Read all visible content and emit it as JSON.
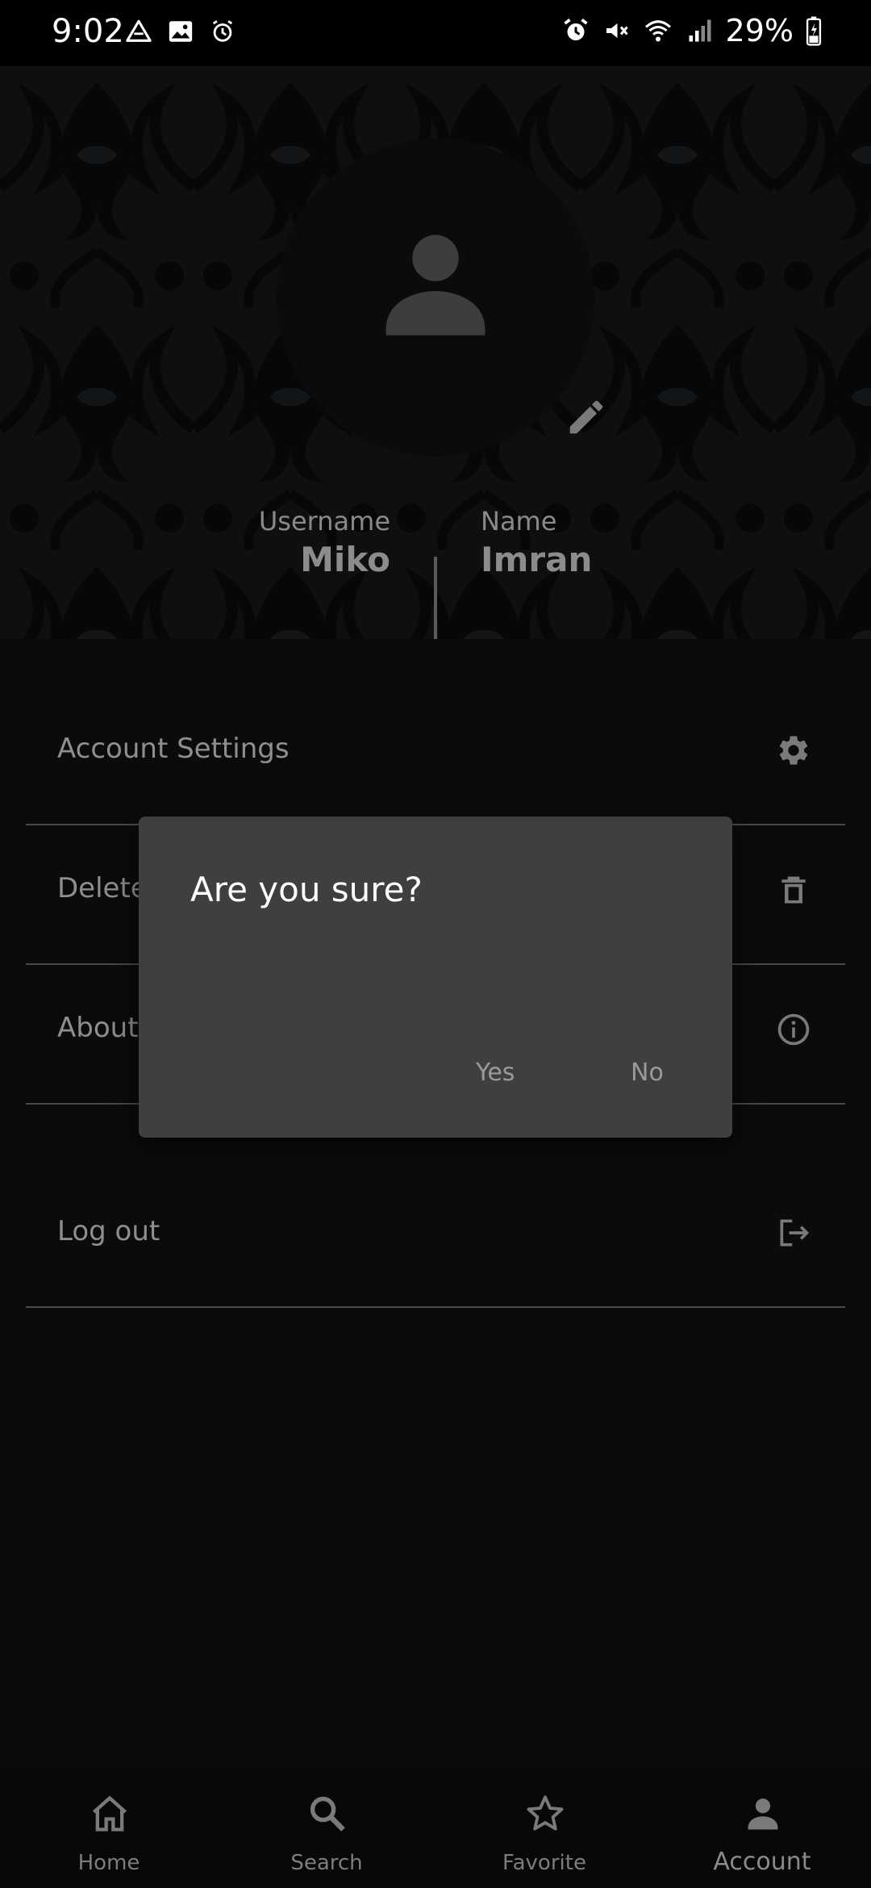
{
  "status_bar": {
    "time": "9:02",
    "battery": "29%",
    "left_icons": [
      "drive-icon",
      "gallery-icon",
      "alarm-icon"
    ],
    "right_icons": [
      "alarm-icon",
      "vibrate-mute-icon",
      "wifi-icon",
      "signal-icon",
      "battery-charging-icon"
    ]
  },
  "profile": {
    "username_label": "Username",
    "username_value": "Miko",
    "name_label": "Name",
    "name_value": "Imran"
  },
  "menu": {
    "items": [
      {
        "label": "Account Settings",
        "icon": "gear-icon"
      },
      {
        "label": "Delete",
        "icon": "trash-icon"
      },
      {
        "label": "About",
        "icon": "info-icon"
      }
    ],
    "logout": {
      "label": "Log out",
      "icon": "logout-icon"
    }
  },
  "dialog": {
    "title": "Are you sure?",
    "yes_label": "Yes",
    "no_label": "No"
  },
  "bottom_nav": {
    "items": [
      {
        "label": "Home",
        "icon": "home-icon"
      },
      {
        "label": "Search",
        "icon": "search-icon"
      },
      {
        "label": "Favorite",
        "icon": "star-icon"
      },
      {
        "label": "Account",
        "icon": "account-icon"
      }
    ],
    "active": "Account"
  },
  "colors": {
    "background": "#0b0b0b",
    "dialog": "#3f3f3f",
    "muted_text": "#8e8e8e"
  }
}
